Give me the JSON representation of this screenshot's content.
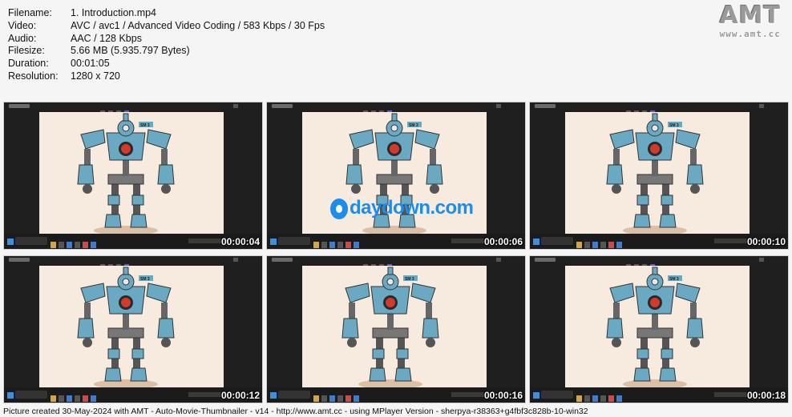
{
  "info": [
    {
      "key": "Filename:",
      "value": "1. Introduction.mp4"
    },
    {
      "key": "Video:",
      "value": "AVC / avc1 / Advanced Video Coding / 583 Kbps / 30 Fps"
    },
    {
      "key": "Audio:",
      "value": "AAC / 128 Kbps"
    },
    {
      "key": "Filesize:",
      "value": "5.66 MB (5.935.797 Bytes)"
    },
    {
      "key": "Duration:",
      "value": "00:01:05"
    },
    {
      "key": "Resolution:",
      "value": "1280 x 720"
    }
  ],
  "logo": {
    "big": "AMT",
    "small": "www.amt.cc"
  },
  "thumbnails": [
    {
      "timestamp": "00:00:04"
    },
    {
      "timestamp": "00:00:06"
    },
    {
      "timestamp": "00:00:10"
    },
    {
      "timestamp": "00:00:12"
    },
    {
      "timestamp": "00:00:16"
    },
    {
      "timestamp": "00:00:18"
    }
  ],
  "watermark": {
    "text": "daydown.com"
  },
  "robot_label": "SM 3",
  "footer": "Picture created 30-May-2024 with AMT - Auto-Movie-Thumbnailer - v14 - http://www.amt.cc - using MPlayer Version - sherpya-r38363+g4fbf3c828b-10-win32",
  "colors": {
    "robot_body": "#6ba9c3",
    "robot_dark": "#3f6f86",
    "robot_eye": "#d23a2e",
    "canvas": "#f6ebde",
    "watermark": "#1e8ce8"
  }
}
